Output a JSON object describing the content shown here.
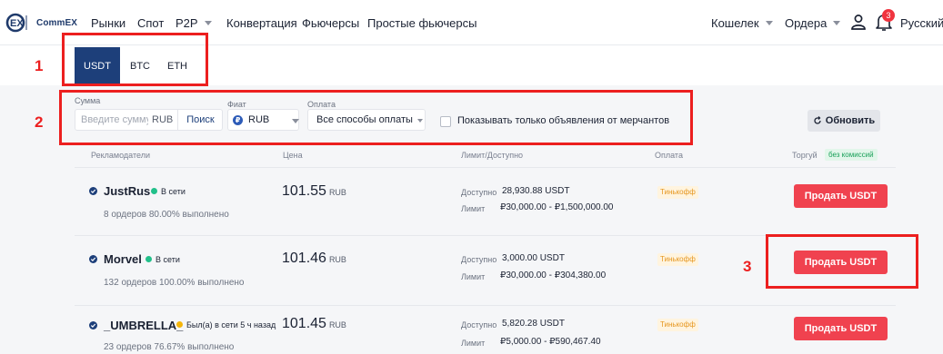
{
  "nav": {
    "brand": "CommEX",
    "links": [
      "Рынки",
      "Спот",
      "P2P",
      "Конвертация",
      "Фьючерсы",
      "Простые фьючерсы"
    ],
    "wallet": "Кошелек",
    "orders": "Ордера",
    "notification_count": "3",
    "language": "Русский"
  },
  "coin_tabs": [
    "USDT",
    "BTC",
    "ETH"
  ],
  "filters": {
    "amount_label": "Сумма",
    "amount_placeholder": "Введите сумму",
    "amount_unit": "RUB",
    "search_label": "Поиск",
    "fiat_label": "Фиат",
    "fiat_value": "RUB",
    "payment_label": "Оплата",
    "payment_value": "Все способы оплаты",
    "merchant_only_label": "Показывать только объявления от мерчантов",
    "refresh_label": "Обновить"
  },
  "table": {
    "headers": {
      "advertisers": "Рекламодатели",
      "price": "Цена",
      "limit": "Лимит/Доступно",
      "payment": "Оплата",
      "trade": "Торгуй",
      "fee_badge": "без комиссий"
    },
    "available_label": "Доступно",
    "limit_label": "Лимит",
    "currency": "RUB",
    "rows": [
      {
        "name": "JustRus",
        "status": "В сети",
        "stats": "8 ордеров 80.00% выполнено",
        "price": "101.55",
        "available": "28,930.88 USDT",
        "limit": "₽30,000.00 - ₽1,500,000.00",
        "payment": "Тинькофф",
        "action": "Продать USDT"
      },
      {
        "name": "Morvel",
        "status": "В сети",
        "stats": "132 ордеров 100.00% выполнено",
        "price": "101.46",
        "available": "3,000.00 USDT",
        "limit": "₽30,000.00 - ₽304,380.00",
        "payment": "Тинькофф",
        "action": "Продать USDT"
      },
      {
        "name": "_UMBRELLA_",
        "status": "Был(а) в сети 5 ч назад",
        "stats": "23 ордеров 76.67% выполнено",
        "price": "101.45",
        "available": "5,820.28 USDT",
        "limit": "₽5,000.00 - ₽590,467.40",
        "payment": "Тинькофф",
        "action": "Продать USDT"
      }
    ]
  },
  "annotations": [
    "1",
    "2",
    "3"
  ],
  "colors": {
    "brand": "#1d3f7a",
    "sell": "#f0424f",
    "online": "#22c08a",
    "away": "#f5b50a",
    "annotation": "#ec1f1f"
  }
}
